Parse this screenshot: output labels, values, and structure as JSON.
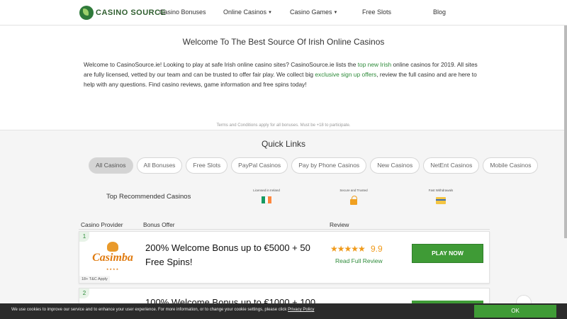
{
  "header": {
    "logo_text": "CASINO SOURCE",
    "nav": [
      {
        "label": "Casino Bonuses",
        "has_caret": false
      },
      {
        "label": "Online Casinos",
        "has_caret": true
      },
      {
        "label": "Casino Games",
        "has_caret": true
      },
      {
        "label": "Free Slots",
        "has_caret": false
      },
      {
        "label": "Blog",
        "has_caret": false
      }
    ]
  },
  "intro": {
    "title": "Welcome To The Best Source Of Irish Online Casinos",
    "text_1": "Welcome to CasinoSource.ie! Looking to play at safe Irish online casino sites? CasinoSource.ie lists the ",
    "link_1": "top new Irish",
    "text_2": " online casinos for 2019. All sites are fully licensed, vetted by our team and can be trusted to offer fair play. We collect big ",
    "link_2": "exclusive sign up offers",
    "text_3": ", review the full casino and are here to help with any questions. Find casino reviews, game information and free spins today!",
    "terms": "Terms and Conditions apply for all bonuses. Must be +18 to participate."
  },
  "quick_links": {
    "title": "Quick Links",
    "pills": [
      "All Casinos",
      "All Bonuses",
      "Free Slots",
      "PayPal Casinos",
      "Pay by Phone Casinos",
      "New Casinos",
      "NetEnt Casinos",
      "Mobile Casinos"
    ],
    "active": "All Casinos"
  },
  "recommended": {
    "title": "Top Recommended Casinos",
    "features": [
      {
        "label": "Licensed in Ireland",
        "icon": "irish-flag-icon"
      },
      {
        "label": "Secure and Trusted",
        "icon": "lock-icon"
      },
      {
        "label": "Fast Withdrawals",
        "icon": "credit-card-icon"
      }
    ]
  },
  "table": {
    "headers": {
      "provider": "Casino Provider",
      "offer": "Bonus Offer",
      "review": "Review"
    },
    "rows": [
      {
        "rank": "1",
        "casino": "Casimba",
        "offer": "200% Welcome Bonus up to €5000 + 50 Free Spins!",
        "stars": "★★★★★",
        "score": "9.9",
        "review_link": "Read Full Review",
        "cta": "PLAY NOW",
        "tc": "18+ T&C Apply"
      },
      {
        "rank": "2",
        "offer": "100% Welcome Bonus up to €1000 + 100"
      }
    ]
  },
  "cookie": {
    "text": "We use cookies to improve our service and to enhance your user experience. For more information, or to change your cookie settings, please click ",
    "policy_link": "Privacy Policy",
    "ok": "OK"
  },
  "colors": {
    "brand_green": "#3f9b36",
    "link_green": "#2e8b3a",
    "star_orange": "#f09a1a",
    "flag_green": "#169b62",
    "flag_white": "#ffffff",
    "flag_orange": "#ff883e"
  }
}
